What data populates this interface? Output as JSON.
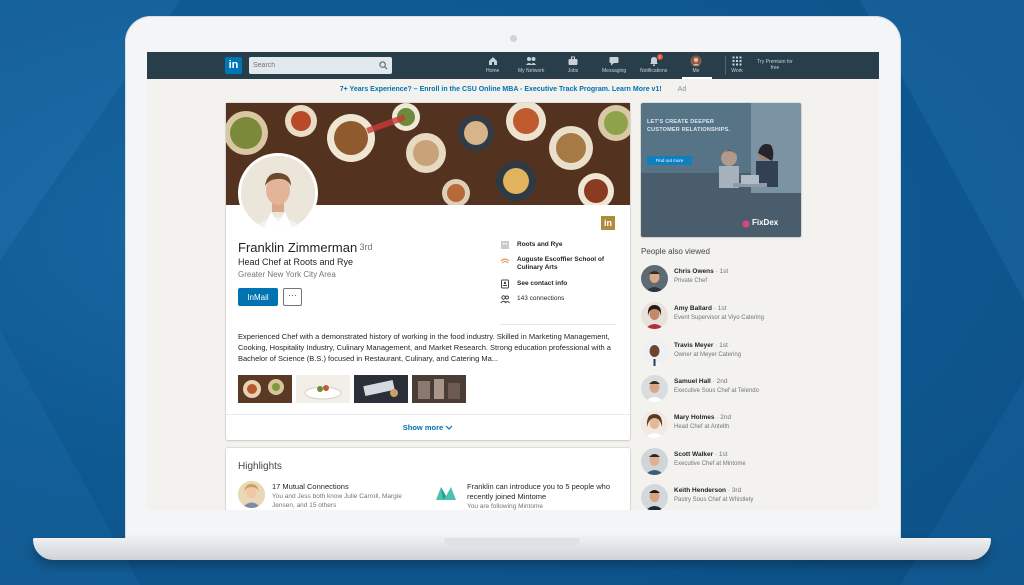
{
  "nav": {
    "logo": "in",
    "search_placeholder": "Search",
    "items": [
      {
        "label": "Home"
      },
      {
        "label": "My Network"
      },
      {
        "label": "Jobs"
      },
      {
        "label": "Messaging"
      },
      {
        "label": "Notifications",
        "badge": "2"
      },
      {
        "label": "Me"
      },
      {
        "label": "Work"
      }
    ],
    "premium": "Try Premium for free"
  },
  "ad_line": {
    "text": "7+ Years Experience? – Enroll in the CSU Online MBA - Executive Track Program. Learn More v1!",
    "tag": "Ad"
  },
  "profile": {
    "name": "Franklin Zimmerman",
    "degree": "· 3rd",
    "headline": "Head Chef at Roots and Rye",
    "location": "Greater New York City Area",
    "inmail_label": "InMail",
    "more_label": "···",
    "company": "Roots and Rye",
    "school": "Auguste Escoffier School of Culinary Arts",
    "contact": "See contact info",
    "connections": "143 connections",
    "summary": "Experienced Chef with a demonstrated history of working in the food industry. Skilled in Marketing Management, Cooking, Hospitality Industry, Culinary Management, and Market Research. Strong education professional with a Bachelor of Science (B.S.) focused in Restaurant, Culinary, and Catering Ma...",
    "show_more": "Show more",
    "badge": "in"
  },
  "highlights": {
    "title": "Highlights",
    "mutual_title": "17 Mutual Connections",
    "mutual_sub": "You and Jess both know Julie Carroll, Margie Jensen, and 15 others",
    "intro_title": "Franklin can introduce you to 5 people who recently joined Mintome",
    "intro_sub": "You are following Mintome"
  },
  "ad": {
    "text": "LET'S CREATE DEEPER CUSTOMER RELATIONSHIPS.",
    "button": "Find out more",
    "brand": "FixDex"
  },
  "people_also_viewed": {
    "title": "People also viewed",
    "people": [
      {
        "name": "Chris Owens",
        "degree": "· 1st",
        "role": "Private Chef"
      },
      {
        "name": "Amy Ballard",
        "degree": "· 1st",
        "role": "Event Supervisor at Viyo Catering"
      },
      {
        "name": "Travis Meyer",
        "degree": "· 1st",
        "role": "Owner at Meyer Catering"
      },
      {
        "name": "Samuel Hall",
        "degree": "· 2nd",
        "role": "Executive Sous Chef at Telendo"
      },
      {
        "name": "Mary Holmes",
        "degree": "· 2nd",
        "role": "Head Chef at Antelth"
      },
      {
        "name": "Scott Walker",
        "degree": "· 1st",
        "role": "Executive Chef at Mintome"
      },
      {
        "name": "Keith Henderson",
        "degree": "· 3rd",
        "role": "Pastry Sous Chef at Whistlety"
      }
    ]
  }
}
